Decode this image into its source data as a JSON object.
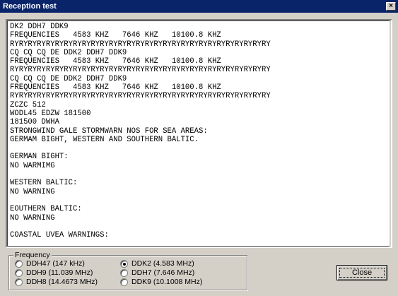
{
  "window": {
    "title": "Reception test",
    "close_glyph": "×"
  },
  "textarea": {
    "lines": [
      "DK2 DDH7 DDK9",
      "FREQUENCIES   4583 KHZ   7646 KHZ   10100.8 KHZ",
      "RYRYRYRYRYRYRYRYRYRYRYRYRYRYRYRYRYRYRYRYRYRYRYRYRYRYRYRYRY",
      "CQ CQ CQ DE DDK2 DDH7 DDK9",
      "FREQUENCIES   4583 KHZ   7646 KHZ   10100.8 KHZ",
      "RYRYRYRYRYRYRYRYRYRYRYRYRYRYRYRYRYRYRYRYRYRYRYRYRYRYRYRYRY",
      "CQ CQ CQ DE DDK2 DDH7 DDK9",
      "FREQUENCIES   4583 KHZ   7646 KHZ   10100.8 KHZ",
      "RYRYRYRYRYRYRYRYRYRYRYRYRYRYRYRYRYRYRYRYRYRYRYRYRYRYRYRYRY",
      "ZCZC 512",
      "WODL45 EDZW 181500",
      "181500 DWHA",
      "STRONGWIND GALE STORMWARN NOS FOR SEA AREAS:",
      "GERMAM BIGHT, WESTERN AND SOUTHERN BALTIC.",
      "",
      "GERMAN BIGHT:",
      "NO WARMIMG",
      "",
      "WESTERN BALTIC:",
      "NO WARNING",
      "",
      "EOUTHERN BALTIC:",
      "NO WARNING",
      "",
      "COASTAL UVEA WARNINGS:"
    ]
  },
  "frequency": {
    "legend": "Frequency",
    "options": [
      {
        "label": "DDH47 (147 kHz)",
        "checked": false
      },
      {
        "label": "DDH9 (11.039 MHz)",
        "checked": false
      },
      {
        "label": "DDH8 (14.4673 MHz)",
        "checked": false
      },
      {
        "label": "DDK2 (4.583 MHz)",
        "checked": true
      },
      {
        "label": "DDH7 (7.646 MHz)",
        "checked": false
      },
      {
        "label": "DDK9 (10.1008 MHz)",
        "checked": false
      }
    ]
  },
  "buttons": {
    "close_label": "Close"
  }
}
